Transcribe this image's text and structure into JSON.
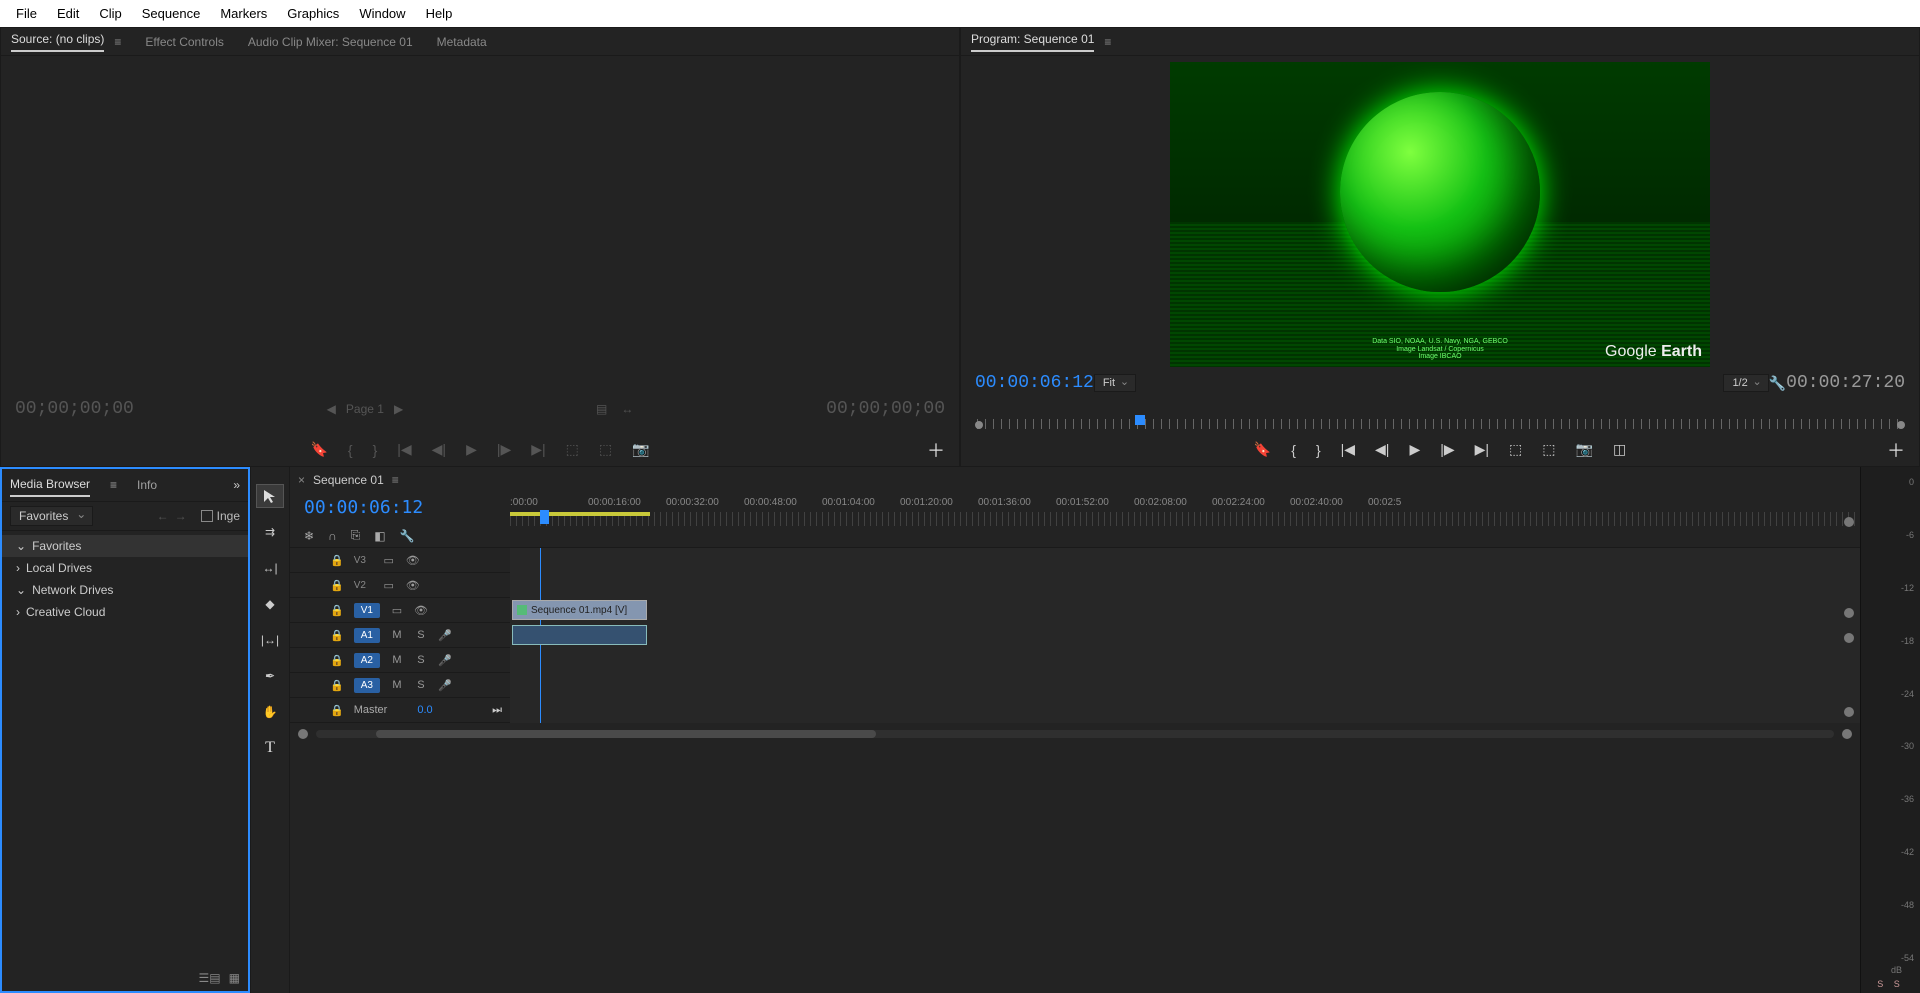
{
  "menu": [
    "File",
    "Edit",
    "Clip",
    "Sequence",
    "Markers",
    "Graphics",
    "Window",
    "Help"
  ],
  "source": {
    "tabs": [
      "Source: (no clips)",
      "Effect Controls",
      "Audio Clip Mixer: Sequence 01",
      "Metadata"
    ],
    "tc_left": "00;00;00;00",
    "page": "Page 1",
    "tc_right": "00;00;00;00"
  },
  "program": {
    "tab": "Program: Sequence 01",
    "tc_left": "00:00:06:12",
    "fit": "Fit",
    "res": "1/2",
    "tc_right": "00:00:27:20",
    "watermark_a": "Google",
    "watermark_b": "Earth",
    "credits1": "Data SIO, NOAA, U.S. Navy, NGA, GEBCO",
    "credits2": "Image Landsat / Copernicus",
    "credits3": "Image IBCAO"
  },
  "media": {
    "tab1": "Media Browser",
    "tab2": "Info",
    "favorites": "Favorites",
    "ingest": "Inge",
    "tree": [
      "Favorites",
      "Local Drives",
      "Network Drives",
      "Creative Cloud"
    ]
  },
  "timeline": {
    "tab": "Sequence 01",
    "tc": "00:00:06:12",
    "ruler": [
      ":00:00",
      "00:00:16:00",
      "00:00:32:00",
      "00:00:48:00",
      "00:01:04:00",
      "00:01:20:00",
      "00:01:36:00",
      "00:01:52:00",
      "00:02:08:00",
      "00:02:24:00",
      "00:02:40:00",
      "00:02:5"
    ],
    "tracks_v": [
      "V3",
      "V2",
      "V1"
    ],
    "tracks_a": [
      "A1",
      "A2",
      "A3"
    ],
    "master": "Master",
    "master_val": "0.0",
    "clip_v": "Sequence 01.mp4 [V]",
    "mute": "M",
    "solo": "S"
  },
  "meter": {
    "scale": [
      "0",
      "-6",
      "-12",
      "-18",
      "-24",
      "-30",
      "-36",
      "-42",
      "-48",
      "-54"
    ],
    "db": "dB",
    "ss": "S  S"
  }
}
